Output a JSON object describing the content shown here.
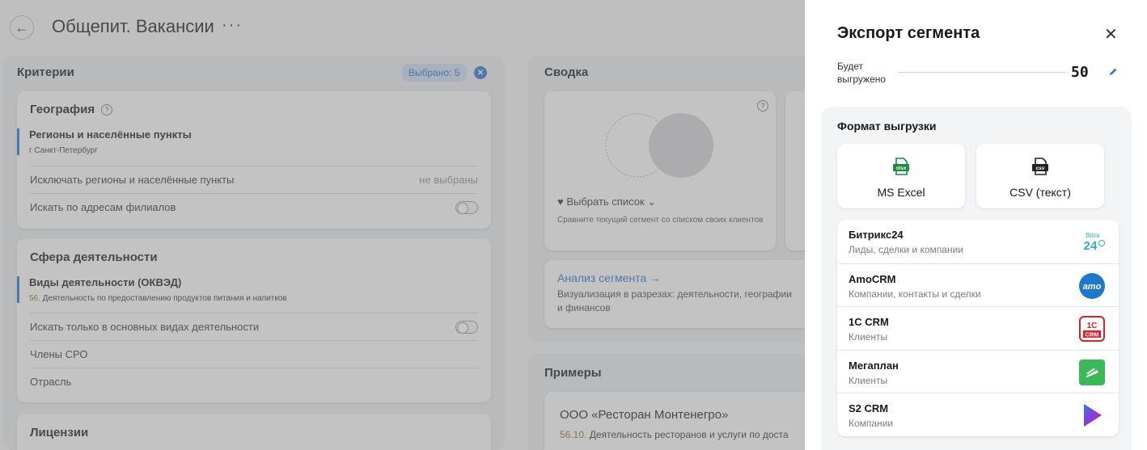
{
  "header": {
    "back_icon": "←",
    "title": "Общепит. Вакансии",
    "menu_icon": "···"
  },
  "criteria": {
    "title": "Критерии",
    "selected_badge": "Выбрано: 5",
    "clear_icon": "✕",
    "geography": {
      "title": "География",
      "help_icon": "?",
      "regions_label": "Регионы и населённые пункты",
      "regions_value": "г Санкт-Петербург",
      "exclude_label": "Исключать регионы и населённые пункты",
      "exclude_value": "не выбраны",
      "branches_label": "Искать по адресам филиалов",
      "branches_toggle": false
    },
    "activity": {
      "title": "Сфера деятельности",
      "okved_label": "Виды деятельности (ОКВЭД)",
      "okved_code": "56.",
      "okved_value": " Деятельность по предоставлению продуктов питания и напитков",
      "main_only_label": "Искать только в основных видах деятельности",
      "main_only_toggle": false,
      "sro_label": "Члены СРО",
      "industry_label": "Отрасль"
    },
    "licenses": {
      "title": "Лицензии"
    }
  },
  "summary": {
    "title": "Сводка",
    "help_icon": "?",
    "pick_list": "♥ Выбрать список ⌄",
    "pick_desc": "Сравните текущий сегмент со списком своих клиентов",
    "analysis_link": "Анализ сегмента →",
    "analysis_desc": "Визуализация в разрезах: деятельности, географии и финансов"
  },
  "examples": {
    "title": "Примеры",
    "company_name": "ООО «Ресторан Монтенегро»",
    "company_code": "56.10.",
    "company_activity": " Деятельность ресторанов и услуги по доста"
  },
  "drawer": {
    "title": "Экспорт сегмента",
    "close_icon": "✕",
    "will_export_label": "Будет выгружено",
    "will_export_count": "50",
    "format_title": "Формат выгрузки",
    "formats": [
      {
        "label": "MS Excel",
        "icon": "xlsx-file-icon",
        "icon_text": "xlsx",
        "color": "#1d8b3f"
      },
      {
        "label": "CSV (текст)",
        "icon": "csv-file-icon",
        "icon_text": "csv",
        "color": "#222222"
      }
    ],
    "integrations": [
      {
        "name": "Битрикс24",
        "desc": "Лиды, сделки и компании",
        "logo": "bitrix24-logo",
        "logo_text_top": "Bitrix",
        "logo_text_main": "24"
      },
      {
        "name": "AmoCRM",
        "desc": "Компании, контакты и сделки",
        "logo": "amocrm-logo",
        "logo_text": "amo"
      },
      {
        "name": "1С CRM",
        "desc": "Клиенты",
        "logo": "1c-crm-logo",
        "logo_text_top": "1С",
        "logo_text_main": "CRM"
      },
      {
        "name": "Мегаплан",
        "desc": "Клиенты",
        "logo": "megaplan-logo"
      },
      {
        "name": "S2 CRM",
        "desc": "Компании",
        "logo": "s2crm-logo"
      }
    ]
  },
  "colors": {
    "accent": "#2a6ccf",
    "okved_code": "#8a6a1a",
    "excel_green": "#1d8b3f",
    "amo_blue": "#1f77c9",
    "onec_red": "#e0202a",
    "megaplan_green": "#3cb85a"
  }
}
